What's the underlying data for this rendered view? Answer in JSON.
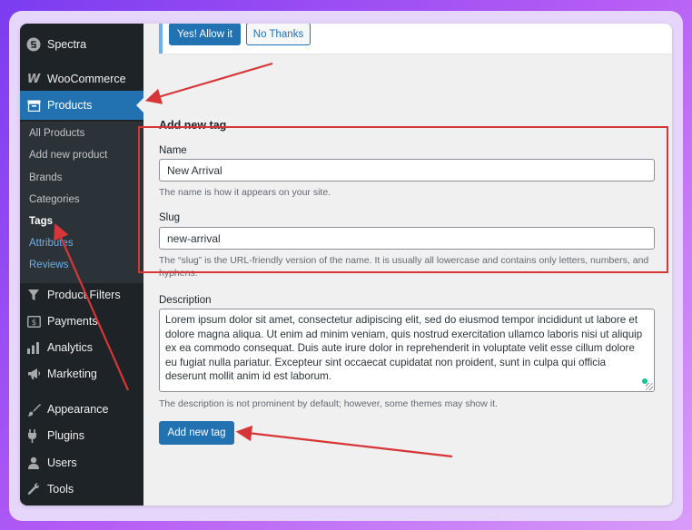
{
  "sidebar": {
    "top_items": [
      {
        "label": "Spectra",
        "icon": "spectra-icon"
      },
      {
        "label": "WooCommerce",
        "icon": "woocommerce-icon"
      },
      {
        "label": "Products",
        "icon": "products-icon",
        "active": true
      }
    ],
    "submenu": [
      {
        "label": "All Products"
      },
      {
        "label": "Add new product"
      },
      {
        "label": "Brands"
      },
      {
        "label": "Categories"
      },
      {
        "label": "Tags",
        "current": true
      },
      {
        "label": "Attributes"
      },
      {
        "label": "Reviews"
      }
    ],
    "bottom_items": [
      {
        "label": "Product Filters",
        "icon": "filter-icon"
      },
      {
        "label": "Payments",
        "icon": "payments-icon"
      },
      {
        "label": "Analytics",
        "icon": "analytics-icon"
      },
      {
        "label": "Marketing",
        "icon": "marketing-icon"
      },
      {
        "label": "Appearance",
        "icon": "appearance-icon"
      },
      {
        "label": "Plugins",
        "icon": "plugins-icon"
      },
      {
        "label": "Users",
        "icon": "users-icon"
      },
      {
        "label": "Tools",
        "icon": "tools-icon"
      }
    ]
  },
  "notice": {
    "allow_label": "Yes! Allow it",
    "decline_label": "No Thanks"
  },
  "form": {
    "heading": "Add new tag",
    "name_label": "Name",
    "name_value": "New Arrival",
    "name_hint": "The name is how it appears on your site.",
    "slug_label": "Slug",
    "slug_value": "new-arrival",
    "slug_hint": "The “slug” is the URL-friendly version of the name. It is usually all lowercase and contains only letters, numbers, and hyphens.",
    "description_label": "Description",
    "description_value": "Lorem ipsum dolor sit amet, consectetur adipiscing elit, sed do eiusmod tempor incididunt ut labore et dolore magna aliqua. Ut enim ad minim veniam, quis nostrud exercitation ullamco laboris nisi ut aliquip ex ea commodo consequat. Duis aute irure dolor in reprehenderit in voluptate velit esse cillum dolore eu fugiat nulla pariatur. Excepteur sint occaecat cupidatat non proident, sunt in culpa qui officia deserunt mollit anim id est laborum.",
    "description_hint": "The description is not prominent by default; however, some themes may show it.",
    "submit_label": "Add new tag"
  },
  "colors": {
    "sidebar_bg": "#1d2327",
    "accent": "#2271b1",
    "annotation_red": "#d63638"
  }
}
